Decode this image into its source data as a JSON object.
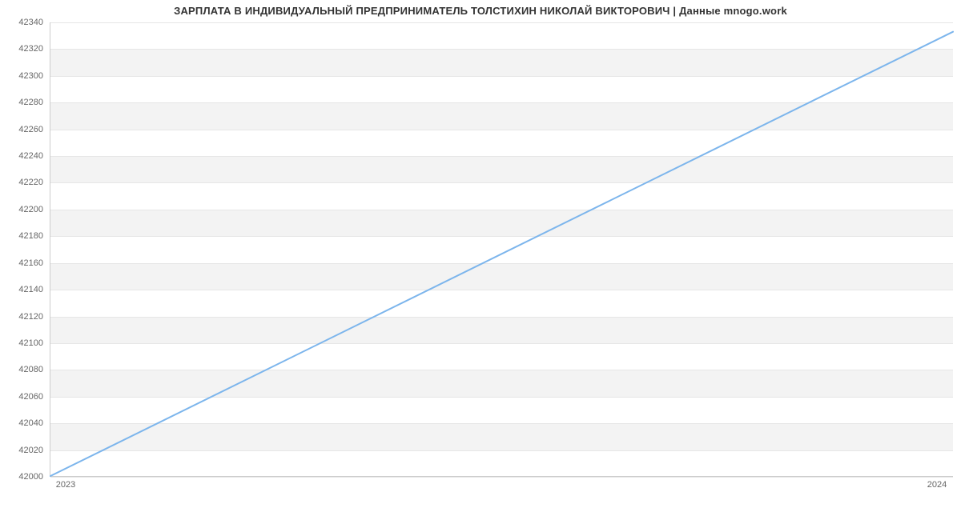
{
  "chart_data": {
    "type": "line",
    "title": "ЗАРПЛАТА В ИНДИВИДУАЛЬНЫЙ ПРЕДПРИНИМАТЕЛЬ ТОЛСТИХИН НИКОЛАЙ ВИКТОРОВИЧ | Данные mnogo.work",
    "x": [
      2023,
      2024
    ],
    "values": [
      42000,
      42333
    ],
    "xticks": [
      "2023",
      "2024"
    ],
    "yticks": [
      42000,
      42020,
      42040,
      42060,
      42080,
      42100,
      42120,
      42140,
      42160,
      42180,
      42200,
      42220,
      42240,
      42260,
      42280,
      42300,
      42320,
      42340
    ],
    "xlabel": "",
    "ylabel": "",
    "xlim": [
      2023,
      2024
    ],
    "ylim": [
      42000,
      42340
    ],
    "line_color": "#7cb5ec",
    "band_color": "#f3f3f3"
  }
}
